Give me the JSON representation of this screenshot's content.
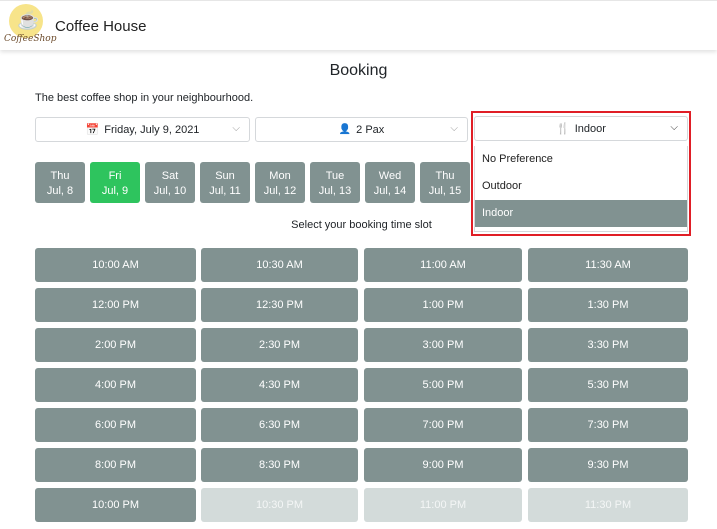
{
  "header": {
    "brand": "Coffee House",
    "logo_text": "CoffeeShop"
  },
  "page": {
    "title": "Booking",
    "tagline": "The best coffee shop in your neighbourhood.",
    "prompt": "Select your booking time slot"
  },
  "selects": {
    "date": {
      "icon": "calendar-icon",
      "value": "Friday, July 9, 2021"
    },
    "pax": {
      "icon": "user-icon",
      "value": "2 Pax"
    },
    "seating": {
      "icon": "utensils-icon",
      "value": "Indoor",
      "options": [
        "No Preference",
        "Outdoor",
        "Indoor"
      ],
      "selected": "Indoor"
    }
  },
  "days": [
    {
      "day": "Thu",
      "date": "Jul, 8"
    },
    {
      "day": "Fri",
      "date": "Jul, 9",
      "selected": true
    },
    {
      "day": "Sat",
      "date": "Jul, 10"
    },
    {
      "day": "Sun",
      "date": "Jul, 11"
    },
    {
      "day": "Mon",
      "date": "Jul, 12"
    },
    {
      "day": "Tue",
      "date": "Jul, 13"
    },
    {
      "day": "Wed",
      "date": "Jul, 14"
    },
    {
      "day": "Thu",
      "date": "Jul, 15"
    }
  ],
  "slots": [
    {
      "t": "10:00 AM"
    },
    {
      "t": "10:30 AM"
    },
    {
      "t": "11:00 AM"
    },
    {
      "t": "11:30 AM"
    },
    {
      "t": "12:00 PM"
    },
    {
      "t": "12:30 PM"
    },
    {
      "t": "1:00 PM"
    },
    {
      "t": "1:30 PM"
    },
    {
      "t": "2:00 PM"
    },
    {
      "t": "2:30 PM"
    },
    {
      "t": "3:00 PM"
    },
    {
      "t": "3:30 PM"
    },
    {
      "t": "4:00 PM"
    },
    {
      "t": "4:30 PM"
    },
    {
      "t": "5:00 PM"
    },
    {
      "t": "5:30 PM"
    },
    {
      "t": "6:00 PM"
    },
    {
      "t": "6:30 PM"
    },
    {
      "t": "7:00 PM"
    },
    {
      "t": "7:30 PM"
    },
    {
      "t": "8:00 PM"
    },
    {
      "t": "8:30 PM"
    },
    {
      "t": "9:00 PM"
    },
    {
      "t": "9:30 PM"
    },
    {
      "t": "10:00 PM"
    },
    {
      "t": "10:30 PM",
      "disabled": true
    },
    {
      "t": "11:00 PM",
      "disabled": true
    },
    {
      "t": "11:30 PM",
      "disabled": true
    }
  ],
  "colors": {
    "slot": "#819291",
    "selected_day": "#2ec45e",
    "disabled": "#d3dbda",
    "highlight": "#e01e26"
  }
}
